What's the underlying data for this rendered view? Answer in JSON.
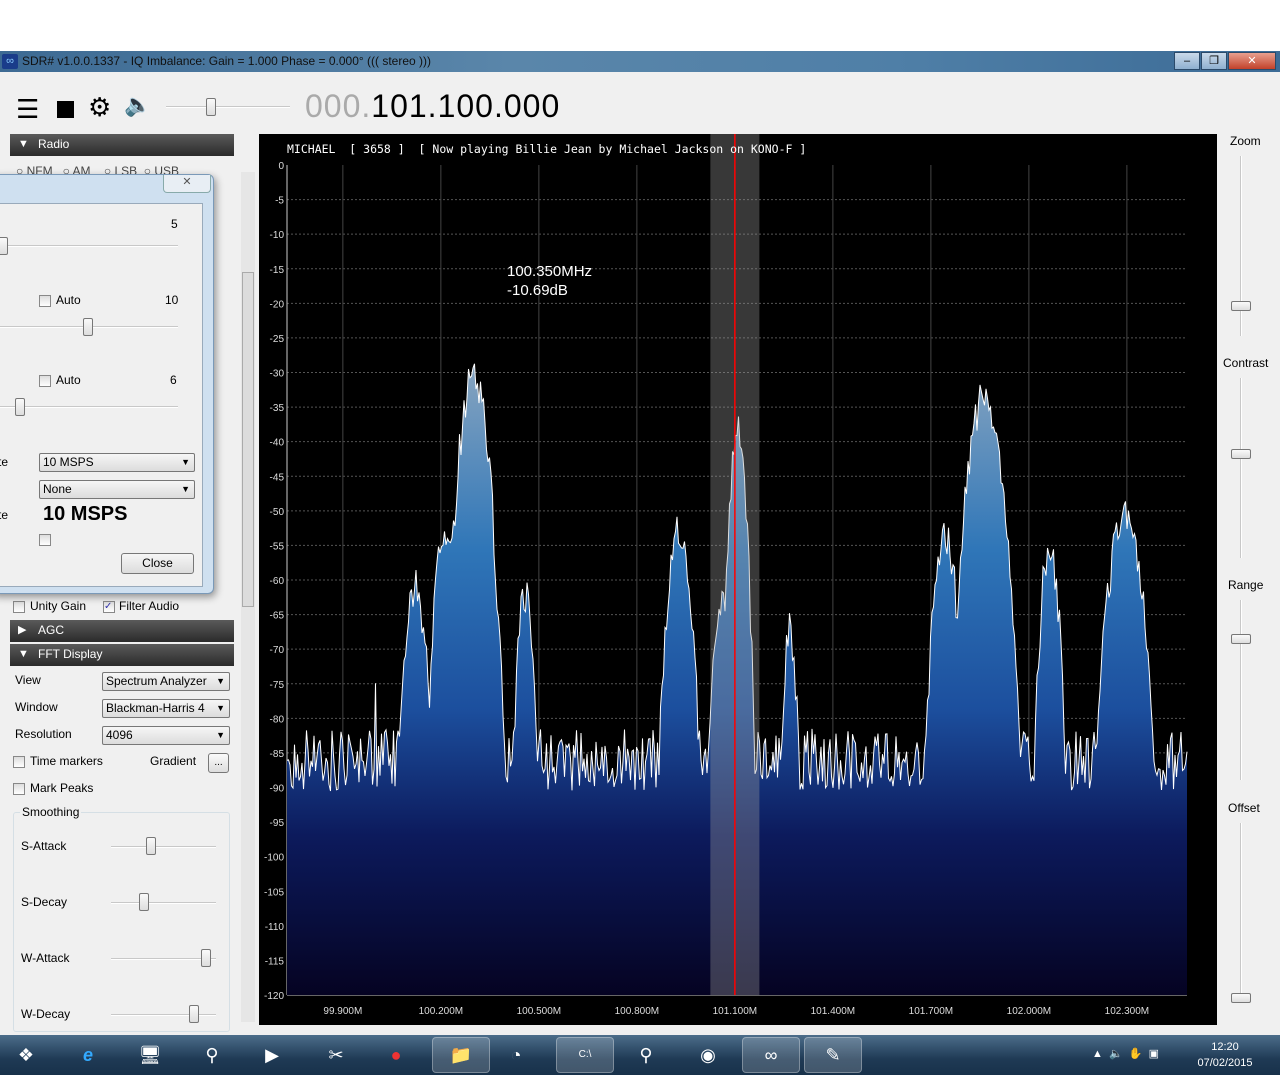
{
  "window": {
    "title": "SDR# v1.0.0.1337 - IQ Imbalance: Gain = 1.000 Phase = 0.000° ((( stereo )))",
    "minimize": "‒",
    "maximize": "❐",
    "close": "✕"
  },
  "toolbar": {
    "freq_dim": "000.",
    "freq_main": "101.100.000",
    "volume": 0.35
  },
  "radio": {
    "header": "Radio",
    "modes": [
      "NFM",
      "AM",
      "LSB",
      "USB"
    ]
  },
  "dialog": {
    "close_x": "✕",
    "val1": "5",
    "auto_label": "Auto",
    "val2": "10",
    "val3": "6",
    "rate_label": "te",
    "rate_value": "10 MSPS",
    "decim_value": "None",
    "rate2_label": "te",
    "rate_big": "10 MSPS",
    "close_btn": "Close",
    "slider1": 0.0,
    "slider2": 0.5,
    "slider3": 0.1
  },
  "audio": {
    "unity_gain": "Unity Gain",
    "filter_audio": "Filter Audio",
    "filter_checked": true
  },
  "agc": {
    "header": "AGC"
  },
  "fft": {
    "header": "FFT Display",
    "view_label": "View",
    "view_value": "Spectrum Analyzer",
    "window_label": "Window",
    "window_value": "Blackman-Harris 4",
    "resolution_label": "Resolution",
    "resolution_value": "4096",
    "time_markers": "Time markers",
    "gradient_label": "Gradient",
    "gradient_btn": "...",
    "mark_peaks": "Mark Peaks",
    "smoothing": "Smoothing",
    "sliders": [
      {
        "label": "S-Attack",
        "value": 0.4
      },
      {
        "label": "S-Decay",
        "value": 0.33
      },
      {
        "label": "W-Attack",
        "value": 0.95
      },
      {
        "label": "W-Decay",
        "value": 0.83
      }
    ]
  },
  "spectrum": {
    "rds": "MICHAEL  [ 3658 ]  [ Now playing Billie Jean by Michael Jackson on KONO-F ]",
    "cursor_freq": "100.350MHz",
    "cursor_db": "-10.69dB",
    "db_ticks": [
      "0",
      "-5",
      "-10",
      "-15",
      "-20",
      "-25",
      "-30",
      "-35",
      "-40",
      "-45",
      "-50",
      "-55",
      "-60",
      "-65",
      "-70",
      "-75",
      "-80",
      "-85",
      "-90",
      "-95",
      "-100",
      "-105",
      "-110",
      "-115",
      "-120"
    ],
    "freq_ticks": [
      "99.900M",
      "100.200M",
      "100.500M",
      "100.800M",
      "101.100M",
      "101.400M",
      "101.700M",
      "102.000M",
      "102.300M"
    ],
    "center_mhz": 101.1,
    "bandwidth_mhz": 0.15,
    "floor_db": -86,
    "peaks": [
      [
        100.0,
        -72,
        0.004
      ],
      [
        100.12,
        -61,
        0.05
      ],
      [
        100.3,
        -30,
        0.06
      ],
      [
        100.21,
        -52,
        0.04
      ],
      [
        100.457,
        -62,
        0.035
      ],
      [
        100.93,
        -52,
        0.05
      ],
      [
        101.109,
        -38,
        0.035
      ],
      [
        101.06,
        -62,
        0.04
      ],
      [
        101.268,
        -67,
        0.03
      ],
      [
        101.743,
        -53,
        0.05
      ],
      [
        101.865,
        -33,
        0.07
      ],
      [
        102.064,
        -55,
        0.04
      ],
      [
        102.294,
        -50,
        0.07
      ]
    ]
  },
  "right": {
    "zoom": "Zoom",
    "contrast": "Contrast",
    "range": "Range",
    "offset": "Offset",
    "zoom_val": 0.85,
    "contrast_val": 0.42,
    "range_val": 0.2,
    "offset_val": 1.0
  },
  "taskbar": {
    "time": "12:20",
    "date": "07/02/2015",
    "apps": [
      "start",
      "internet-explorer",
      "remote-desktop",
      "usb-device",
      "media-player",
      "snipping-tool",
      "record",
      "file-explorer",
      "speedometer",
      "command-prompt",
      "usb-device-2",
      "dvd",
      "sdrsharp",
      "notepad"
    ]
  }
}
